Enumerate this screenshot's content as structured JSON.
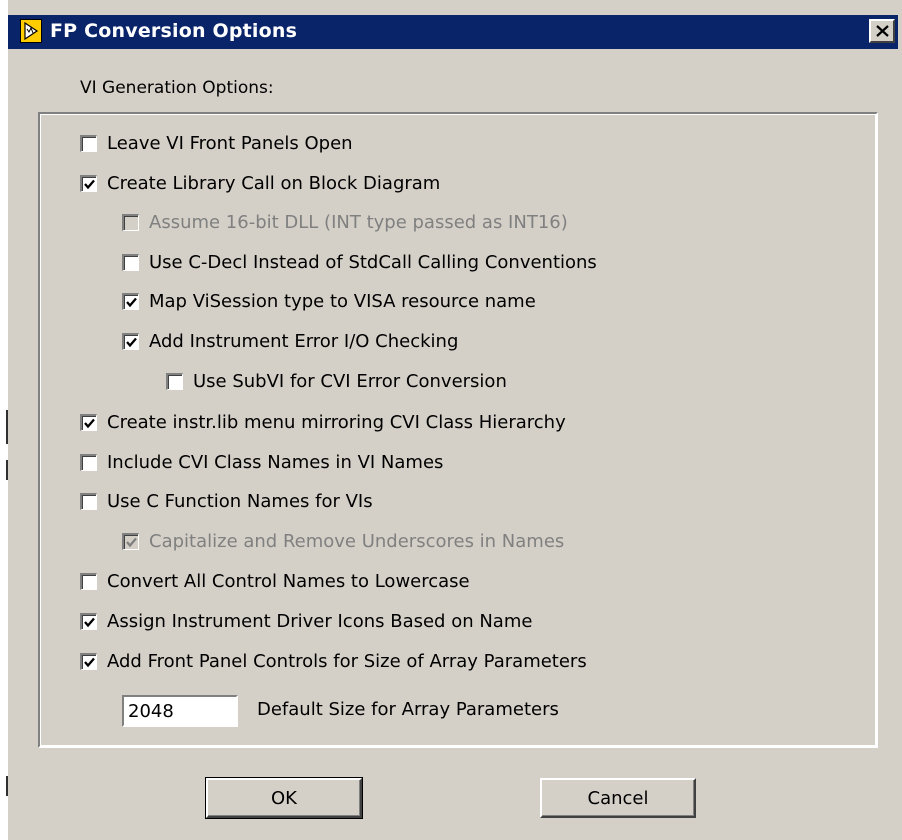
{
  "window": {
    "title": "FP Conversion Options",
    "app_icon": "labview-icon",
    "close_icon": "close-icon"
  },
  "group": {
    "label": "VI Generation Options:"
  },
  "options": [
    {
      "id": "leave-vi-front-panels-open",
      "label": "Leave VI Front Panels Open",
      "checked": false,
      "disabled": false,
      "level": 0
    },
    {
      "id": "create-library-call",
      "label": "Create Library Call on Block Diagram",
      "checked": true,
      "disabled": false,
      "level": 0
    },
    {
      "id": "assume-16bit-dll",
      "label": "Assume 16-bit DLL (INT type passed as INT16)",
      "checked": false,
      "disabled": true,
      "level": 1
    },
    {
      "id": "use-c-decl",
      "label": "Use C-Decl Instead of StdCall Calling Conventions",
      "checked": false,
      "disabled": false,
      "level": 1
    },
    {
      "id": "map-visession",
      "label": "Map ViSession type to VISA resource name",
      "checked": true,
      "disabled": false,
      "level": 1
    },
    {
      "id": "add-instrument-error-io",
      "label": "Add Instrument Error I/O Checking",
      "checked": true,
      "disabled": false,
      "level": 1
    },
    {
      "id": "use-subvi-cvi-error",
      "label": "Use SubVI for CVI Error Conversion",
      "checked": false,
      "disabled": false,
      "level": 2
    },
    {
      "id": "create-instr-lib-menu",
      "label": "Create instr.lib menu mirroring CVI Class Hierarchy",
      "checked": true,
      "disabled": false,
      "level": 0
    },
    {
      "id": "include-cvi-class-names",
      "label": "Include CVI Class Names in VI Names",
      "checked": false,
      "disabled": false,
      "level": 0
    },
    {
      "id": "use-c-function-names",
      "label": "Use C Function Names for VIs",
      "checked": false,
      "disabled": false,
      "level": 0
    },
    {
      "id": "capitalize-remove-underscores",
      "label": "Capitalize and Remove Underscores in Names",
      "checked": true,
      "disabled": true,
      "level": 1
    },
    {
      "id": "convert-control-names-lowercase",
      "label": "Convert All Control Names to Lowercase",
      "checked": false,
      "disabled": false,
      "level": 0
    },
    {
      "id": "assign-instrument-driver-icons",
      "label": "Assign Instrument Driver Icons Based on Name",
      "checked": true,
      "disabled": false,
      "level": 0
    },
    {
      "id": "add-front-panel-controls-array",
      "label": "Add Front Panel Controls for Size of Array Parameters",
      "checked": true,
      "disabled": false,
      "level": 0
    }
  ],
  "array_size": {
    "value": "2048",
    "label": "Default Size for Array Parameters"
  },
  "buttons": {
    "ok": "OK",
    "cancel": "Cancel"
  },
  "colors": {
    "titlebar": "#0a246a",
    "dialog_face": "#d4d0c8",
    "disabled_text": "#808080"
  }
}
